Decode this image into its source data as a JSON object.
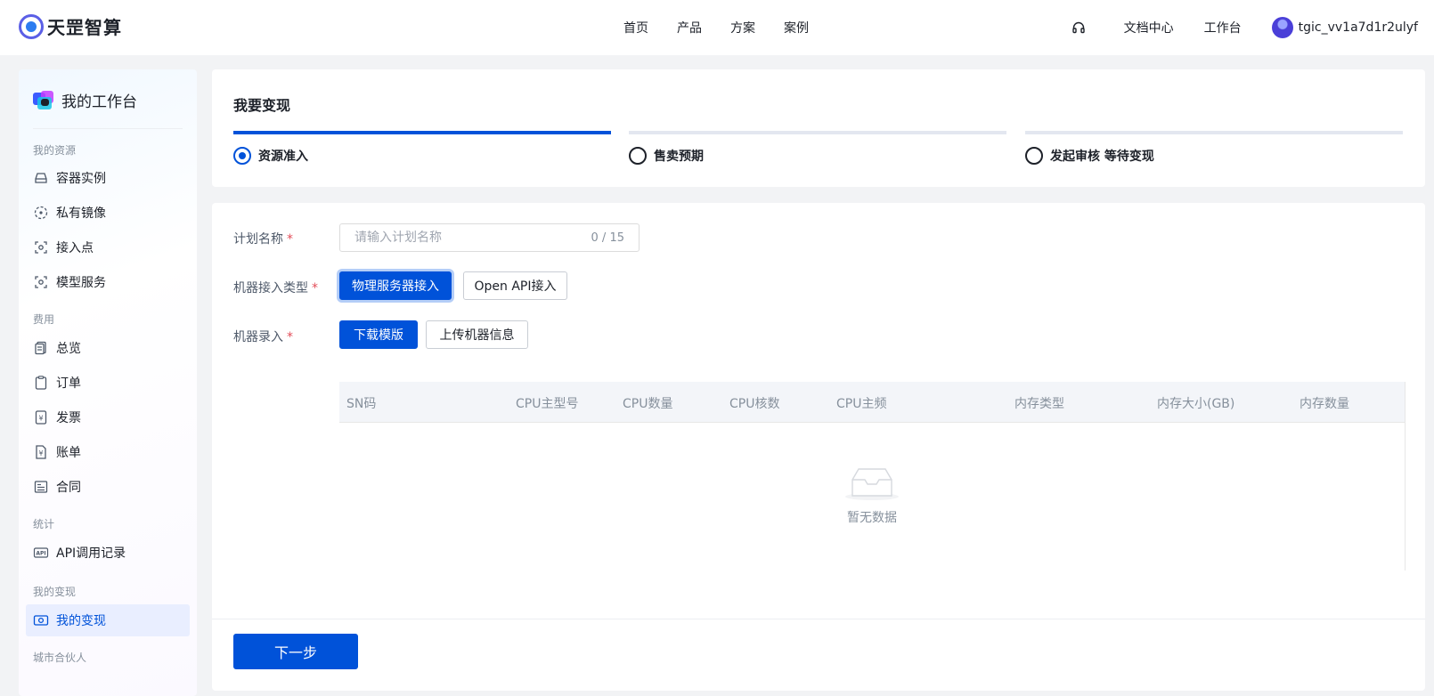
{
  "brand": {
    "name": "天罡智算"
  },
  "nav": {
    "items": [
      "首页",
      "产品",
      "方案",
      "案例"
    ]
  },
  "header": {
    "docs": "文档中心",
    "workbench": "工作台",
    "username": "tgic_vv1a7d1r2ulyf"
  },
  "sidebar": {
    "title": "我的工作台",
    "groups": {
      "resources": "我的资源",
      "billing": "费用",
      "stats": "统计",
      "monetize": "我的变现",
      "partner": "城市合伙人"
    },
    "items": {
      "container": "容器实例",
      "image": "私有镜像",
      "endpoint": "接入点",
      "model": "模型服务",
      "overview": "总览",
      "order": "订单",
      "invoice": "发票",
      "bill": "账单",
      "contract": "合同",
      "api": "API调用记录",
      "monetize": "我的变现"
    }
  },
  "page": {
    "title": "我要变现",
    "steps": [
      "资源准入",
      "售卖预期",
      "发起审核 等待变现"
    ]
  },
  "form": {
    "plan_label": "计划名称",
    "plan_placeholder": "请输入计划名称",
    "plan_value": "",
    "plan_count": "0 / 15",
    "type_label": "机器接入类型",
    "type_physical": "物理服务器接入",
    "type_api": "Open API接入",
    "entry_label": "机器录入",
    "download": "下载模版",
    "upload": "上传机器信息",
    "next": "下一步"
  },
  "table": {
    "columns": [
      "SN码",
      "CPU主型号",
      "CPU数量",
      "CPU核数",
      "CPU主频",
      "内存类型",
      "内存大小(GB)",
      "内存数量"
    ],
    "empty": "暂无数据"
  },
  "colors": {
    "primary": "#0052d9",
    "required": "#e34d59"
  }
}
